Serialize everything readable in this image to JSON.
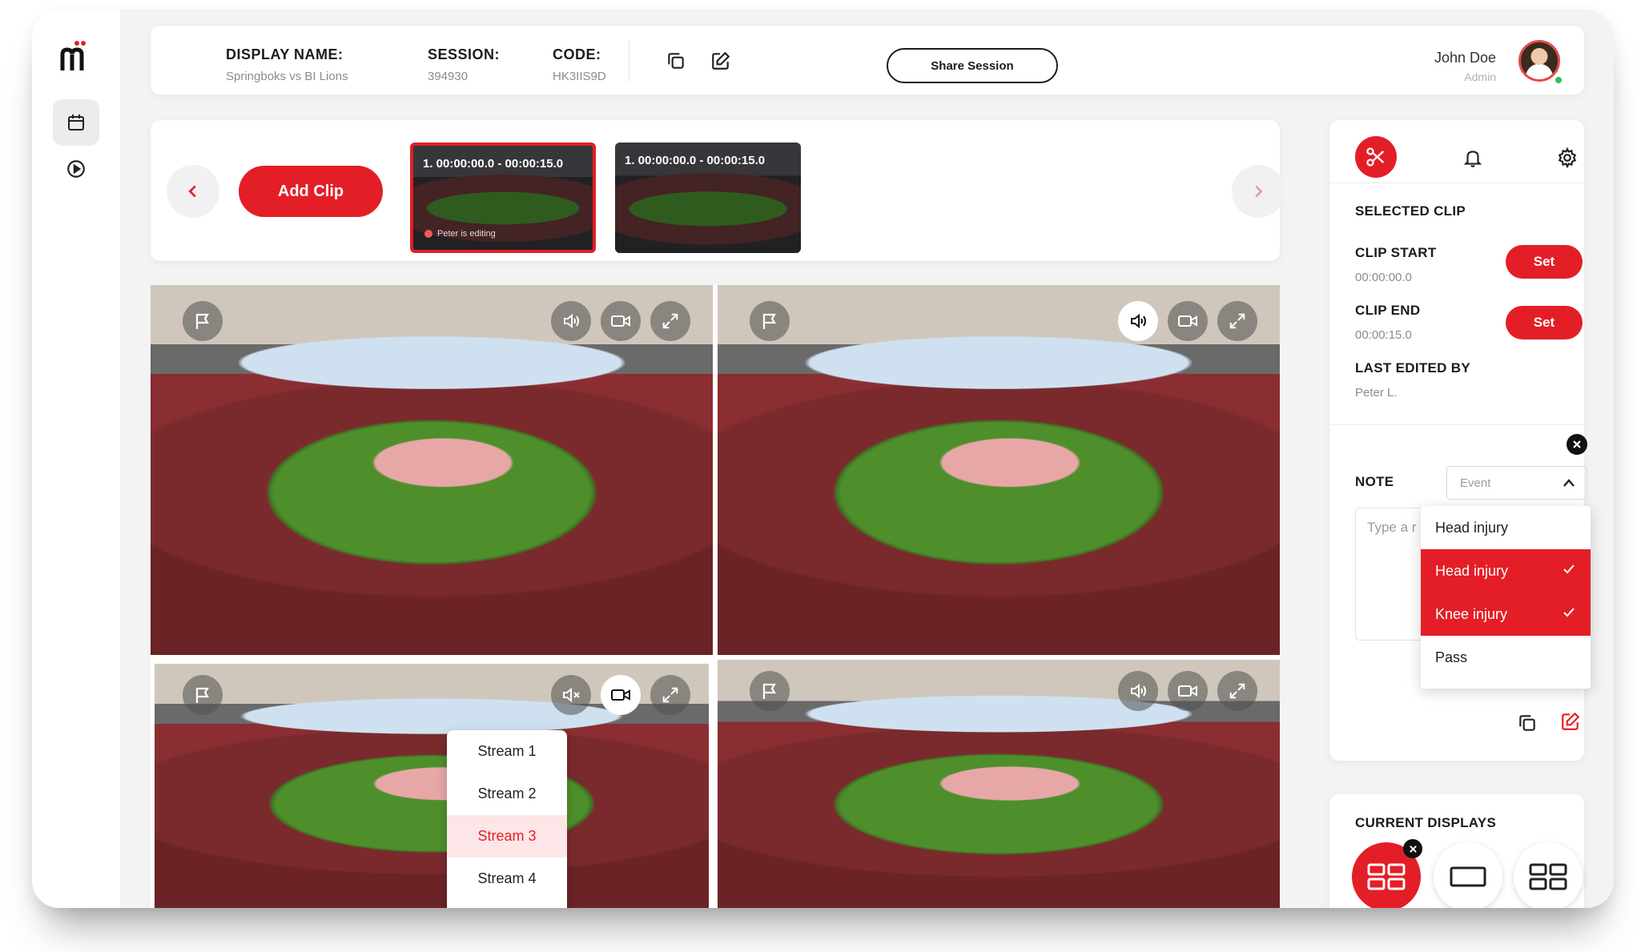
{
  "session": {
    "display_name_label": "DISPLAY NAME:",
    "display_name_value": "Springboks vs BI Lions",
    "session_label": "SESSION:",
    "session_value": "394930",
    "code_label": "CODE:",
    "code_value": "HK3IIS9D",
    "share_label": "Share Session"
  },
  "user": {
    "name": "John Doe",
    "role": "Admin",
    "status_color": "#29c15a"
  },
  "clipbar": {
    "add_clip_label": "Add Clip",
    "clips": [
      {
        "time": "1. 00:00:00.0 - 00:00:15.0",
        "editing": "Peter is editing",
        "selected": true
      },
      {
        "time": "1. 00:00:00.0 - 00:00:15.0",
        "editing": "",
        "selected": false
      }
    ]
  },
  "videos": [
    {
      "audio": "speaker-on",
      "camera_active": false,
      "audio_active": false
    },
    {
      "audio": "speaker-on",
      "camera_active": false,
      "audio_active": true
    },
    {
      "audio": "speaker-muted",
      "camera_active": true,
      "audio_active": false
    },
    {
      "audio": "speaker-on",
      "camera_active": false,
      "audio_active": false
    }
  ],
  "stream_menu": {
    "items": [
      "Stream 1",
      "Stream 2",
      "Stream 3",
      "Stream 4"
    ],
    "selected": "Stream 3"
  },
  "panel": {
    "selected_clip_label": "SELECTED CLIP",
    "clip_start_label": "CLIP START",
    "clip_start_value": "00:00:00.0",
    "clip_end_label": "CLIP END",
    "clip_end_value": "00:00:15.0",
    "set_label": "Set",
    "last_edited_label": "LAST EDITED BY",
    "last_edited_value": "Peter L.",
    "note_label": "NOTE",
    "event_placeholder": "Event",
    "note_placeholder": "Type a r",
    "dropdown": [
      {
        "label": "Head injury",
        "selected": false
      },
      {
        "label": "Head injury",
        "selected": true
      },
      {
        "label": "Knee injury",
        "selected": true
      },
      {
        "label": "Pass",
        "selected": false
      }
    ]
  },
  "displays": {
    "label": "CURRENT DISPLAYS"
  },
  "colors": {
    "accent": "#e41e26",
    "accent_light": "#fde6e7",
    "text_muted": "#8b8b8b"
  }
}
